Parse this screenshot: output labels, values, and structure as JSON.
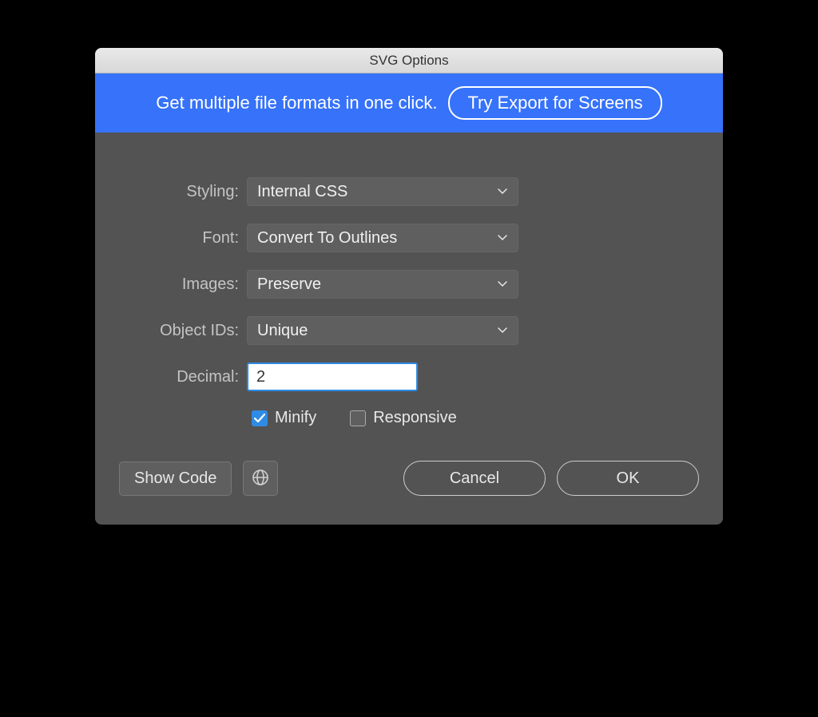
{
  "title": "SVG Options",
  "banner": {
    "text": "Get multiple file formats in one click.",
    "button_label": "Try Export for Screens"
  },
  "form": {
    "styling": {
      "label": "Styling:",
      "value": "Internal CSS"
    },
    "font": {
      "label": "Font:",
      "value": "Convert To Outlines"
    },
    "images": {
      "label": "Images:",
      "value": "Preserve"
    },
    "object_ids": {
      "label": "Object IDs:",
      "value": "Unique"
    },
    "decimal": {
      "label": "Decimal:",
      "value": "2"
    }
  },
  "checkboxes": {
    "minify": {
      "label": "Minify",
      "checked": true
    },
    "responsive": {
      "label": "Responsive",
      "checked": false
    }
  },
  "buttons": {
    "show_code": "Show Code",
    "cancel": "Cancel",
    "ok": "OK"
  }
}
